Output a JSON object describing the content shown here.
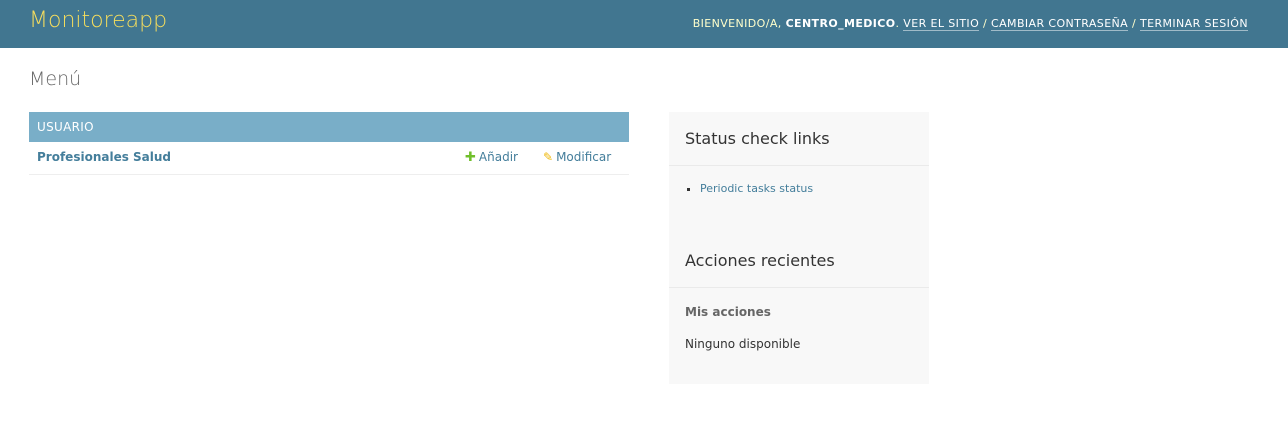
{
  "header": {
    "brand": "Monitoreapp",
    "welcome": "Bienvenido/a, ",
    "username": "CENTRO_MEDICO",
    "after_user": ". ",
    "view_site": "Ver el sitio",
    "sep1": " / ",
    "change_password": "Cambiar contraseña",
    "sep2": " / ",
    "logout": "Terminar sesión"
  },
  "page": {
    "title": "Menú"
  },
  "app_module": {
    "caption": "USUARIO",
    "model": {
      "name": "Profesionales Salud",
      "add_label": "Añadir",
      "change_label": "Modificar"
    }
  },
  "sidebar": {
    "status_heading": "Status check links",
    "status_links": [
      "Periodic tasks status"
    ],
    "recent_heading": "Acciones recientes",
    "my_actions": "Mis acciones",
    "none_available": "Ninguno disponible"
  },
  "colors": {
    "header_bg": "#417690",
    "brand": "#f5dd5d",
    "caption_bg": "#79aec8",
    "link": "#447e9b",
    "add_icon": "#70bf2b",
    "change_icon": "#efb80b"
  },
  "icons": {
    "add": "plus-icon",
    "change": "pencil-icon"
  }
}
